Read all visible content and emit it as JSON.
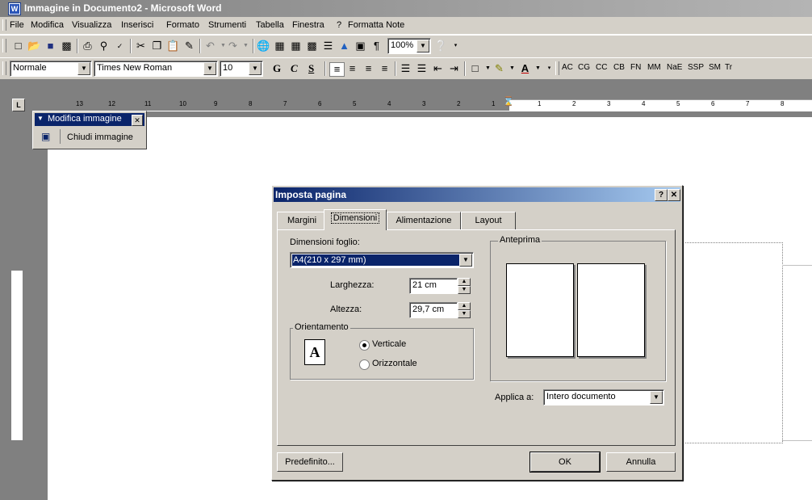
{
  "window": {
    "title": "Immagine in Documento2 - Microsoft Word"
  },
  "menu": [
    "File",
    "Modifica",
    "Visualizza",
    "Inserisci",
    "Formato",
    "Strumenti",
    "Tabella",
    "Finestra",
    "?",
    "Formatta Note"
  ],
  "toolbar": {
    "zoom": "100%",
    "style": "Normale",
    "font": "Times New Roman",
    "size": "10",
    "bold": "G",
    "italic": "C",
    "underline": "S",
    "tags": [
      "AC",
      "CG",
      "CC",
      "CB",
      "FN",
      "MM",
      "NaE",
      "SSP",
      "SM",
      "Tr"
    ]
  },
  "ruler": {
    "left_numbers": [
      "13",
      "12",
      "11",
      "10",
      "9",
      "8",
      "7",
      "6",
      "5",
      "4",
      "3",
      "2",
      "1"
    ],
    "right_numbers": [
      "1",
      "2",
      "3",
      "4",
      "5",
      "6",
      "7",
      "8"
    ]
  },
  "image_toolbar": {
    "title": "Modifica immagine",
    "close_image": "Chiudi immagine"
  },
  "dialog": {
    "title": "Imposta pagina",
    "tabs": [
      "Margini",
      "Dimensioni",
      "Alimentazione",
      "Layout"
    ],
    "paper_size_label": "Dimensioni foglio:",
    "paper_size_value": "A4(210 x 297 mm)",
    "width_label": "Larghezza:",
    "width_value": "21 cm",
    "height_label": "Altezza:",
    "height_value": "29,7 cm",
    "orientation_label": "Orientamento",
    "orientation_icon": "A",
    "portrait": "Verticale",
    "landscape": "Orizzontale",
    "preview_label": "Anteprima",
    "apply_label": "Applica a:",
    "apply_value": "Intero documento",
    "default_button": "Predefinito...",
    "ok_button": "OK",
    "cancel_button": "Annulla"
  }
}
